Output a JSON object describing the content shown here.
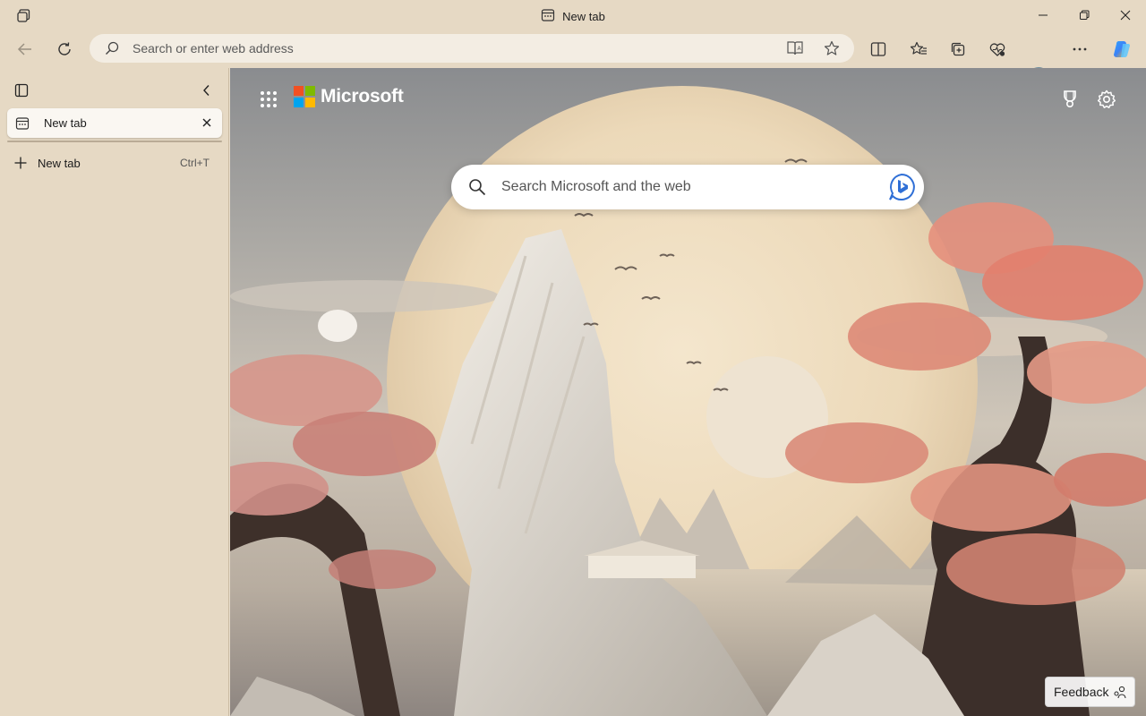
{
  "window": {
    "title": "New tab",
    "controls": {
      "minimize": "minimize-icon",
      "restore": "restore-icon",
      "close": "close-icon"
    }
  },
  "toolbar": {
    "address_placeholder": "Search or enter web address",
    "icons": [
      "back-icon",
      "refresh-icon",
      "search-icon",
      "immersive-reader-icon",
      "favorite-star-icon",
      "split-screen-icon",
      "favorites-icon",
      "collections-icon",
      "browser-essentials-icon",
      "profile-avatar",
      "more-icon",
      "copilot-icon"
    ]
  },
  "sidebar": {
    "tabs": [
      {
        "label": "New tab",
        "active": true
      }
    ],
    "new_tab_label": "New tab",
    "new_tab_shortcut": "Ctrl+T"
  },
  "page": {
    "brand": "Microsoft",
    "search_placeholder": "Search Microsoft and the web",
    "feedback_label": "Feedback",
    "brand_colors": {
      "red": "#f25022",
      "green": "#7fba00",
      "blue": "#00a4ef",
      "yellow": "#ffb900"
    }
  },
  "colors": {
    "chrome": "#e6d9c4",
    "address_bg": "#f3ede3",
    "copilot_accent": "#3b82f6"
  }
}
